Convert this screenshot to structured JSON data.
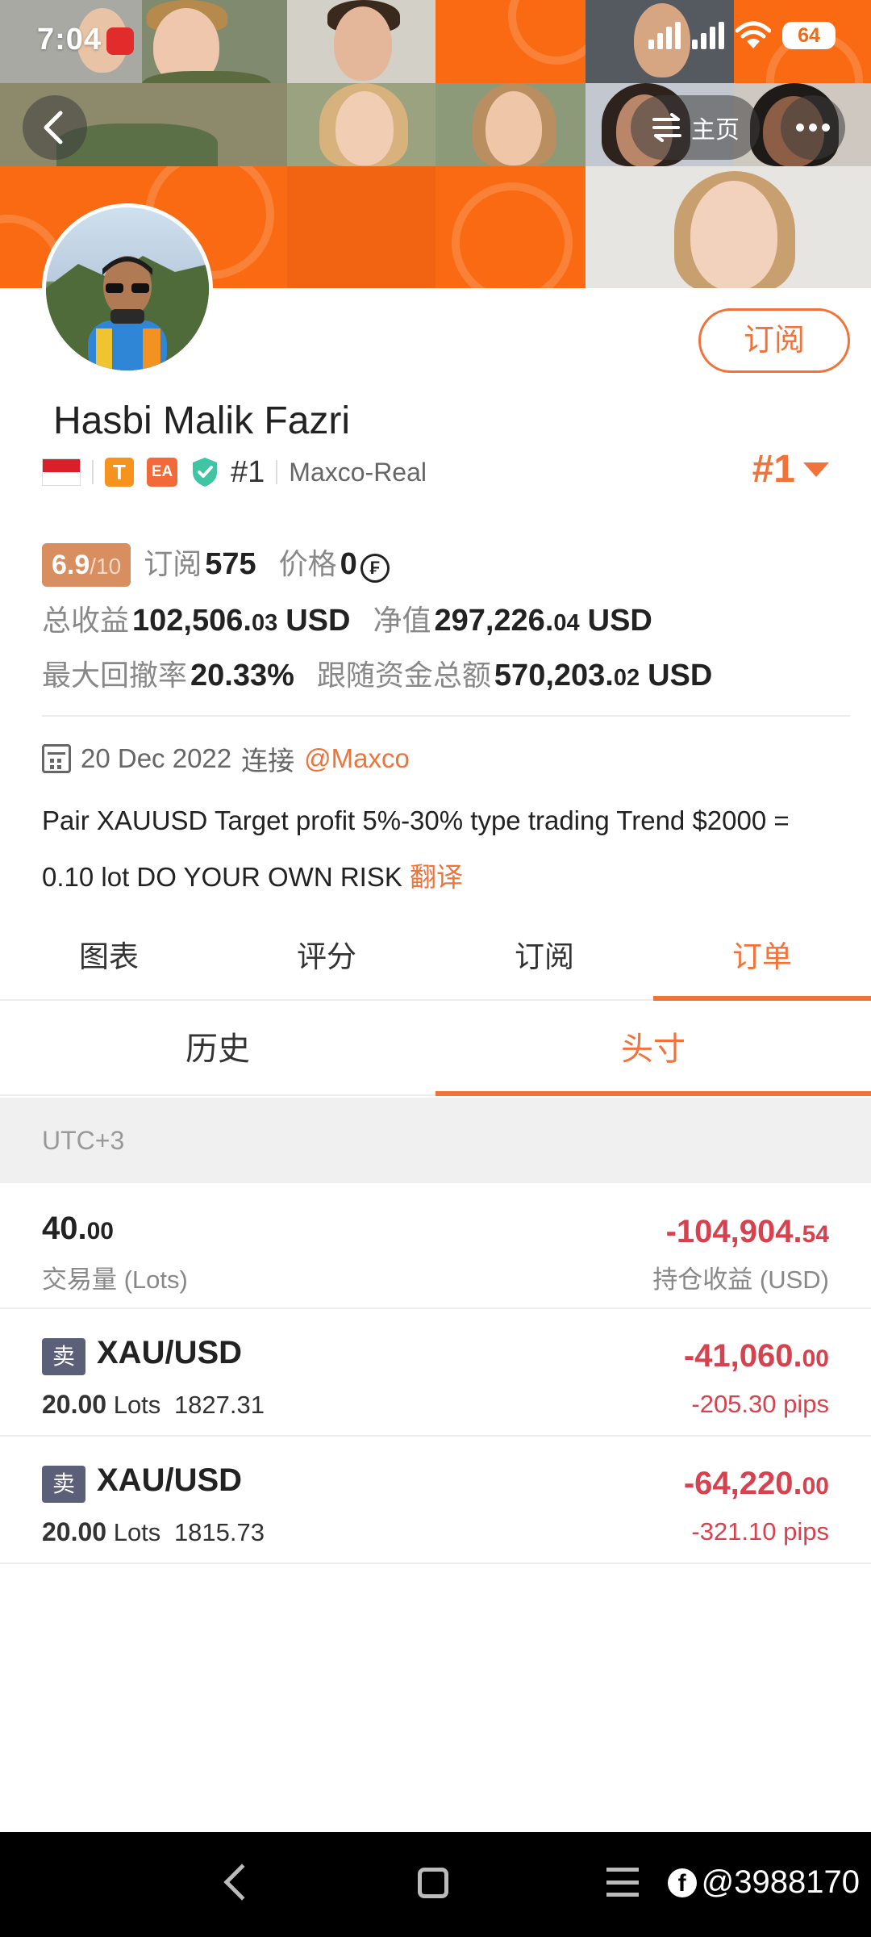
{
  "status_bar": {
    "time": "7:04",
    "battery": "64"
  },
  "header": {
    "home_label": "主页"
  },
  "profile": {
    "name": "Hasbi Malik Fazri",
    "subscribe_label": "订阅",
    "badge_t": "T",
    "badge_ea": "EA",
    "rank_small": "#1",
    "broker": "Maxco-Real",
    "rank_big": "#1"
  },
  "stats": {
    "score": "6.9",
    "score_den": "/10",
    "subscribe_label": "订阅",
    "subscribe_count": "575",
    "price_label": "价格",
    "price_value": "0",
    "coin_symbol": "₣",
    "total_profit_label": "总收益",
    "total_profit_int": "102,506.",
    "total_profit_dec": "03",
    "total_profit_cur": "USD",
    "net_label": "净值",
    "net_int": "297,226.",
    "net_dec": "04",
    "net_cur": "USD",
    "drawdown_label": "最大回撤率",
    "drawdown_value": "20.33%",
    "follow_label": "跟随资金总额",
    "follow_int": "570,203.",
    "follow_dec": "02",
    "follow_cur": "USD"
  },
  "info": {
    "joined_date": "20 Dec 2022",
    "joined_connect": "连接",
    "mention": "@Maxco",
    "description": "Pair XAUUSD Target profit 5%-30% type trading Trend $2000 = 0.10 lot DO YOUR OWN RISK",
    "translate_label": "翻译"
  },
  "tabs": [
    {
      "label": "图表"
    },
    {
      "label": "评分"
    },
    {
      "label": "订阅"
    },
    {
      "label": "订单"
    }
  ],
  "subtabs": [
    {
      "label": "历史"
    },
    {
      "label": "头寸"
    }
  ],
  "timezone": "UTC+3",
  "summary": {
    "lots_int": "40.",
    "lots_dec": "00",
    "lots_label": "交易量 (Lots)",
    "pnl_int": "-104,904.",
    "pnl_dec": "54",
    "pnl_label": "持仓收益 (USD)"
  },
  "positions": [
    {
      "side": "卖",
      "symbol": "XAU/USD",
      "lots": "20.00",
      "lots_unit": "Lots",
      "price": "1827.31",
      "pnl_int": "-41,060.",
      "pnl_dec": "00",
      "pips": "-205.30 pips"
    },
    {
      "side": "卖",
      "symbol": "XAU/USD",
      "lots": "20.00",
      "lots_unit": "Lots",
      "price": "1815.73",
      "pnl_int": "-64,220.",
      "pnl_dec": "00",
      "pips": "-321.10 pips"
    }
  ],
  "watermark": "@3988170",
  "colors": {
    "accent": "#f2733a",
    "loss": "#d6434f",
    "banner": "#fa6a12",
    "sell_badge": "#5b6078"
  }
}
